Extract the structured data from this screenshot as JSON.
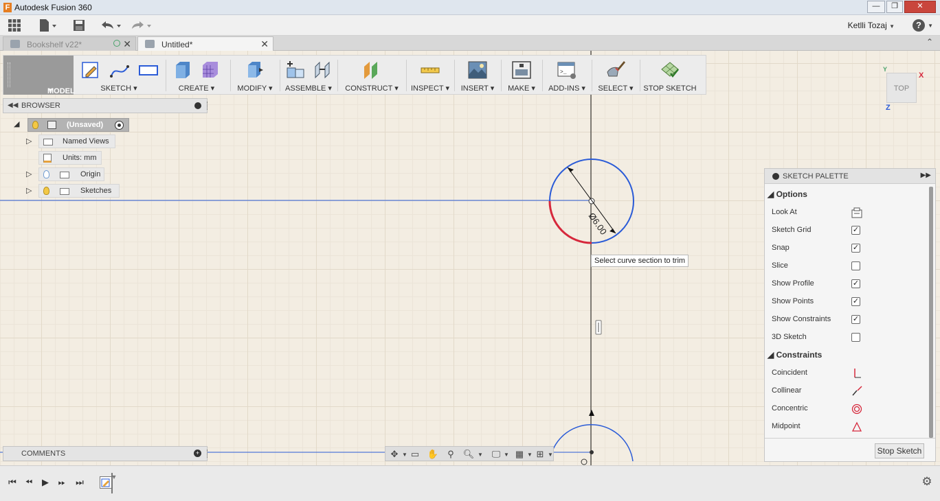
{
  "window": {
    "title": "Autodesk Fusion 360",
    "logo_letter": "F",
    "minimize": "—",
    "maximize": "❐",
    "close": "✕"
  },
  "quick_access": {
    "user_name": "Ketlli Tozaj",
    "help": "?"
  },
  "tabs": [
    {
      "label": "Bookshelf v22*",
      "active": false
    },
    {
      "label": "Untitled*",
      "active": true
    }
  ],
  "ribbon": {
    "workspace": "MODEL",
    "groups": [
      {
        "label": "SKETCH ▾"
      },
      {
        "label": "CREATE ▾"
      },
      {
        "label": "MODIFY ▾"
      },
      {
        "label": "ASSEMBLE ▾"
      },
      {
        "label": "CONSTRUCT ▾"
      },
      {
        "label": "INSPECT ▾"
      },
      {
        "label": "INSERT ▾"
      },
      {
        "label": "MAKE ▾"
      },
      {
        "label": "ADD-INS ▾"
      },
      {
        "label": "SELECT ▾"
      },
      {
        "label": "STOP SKETCH"
      }
    ]
  },
  "browser": {
    "title": "BROWSER",
    "root": "(Unsaved)",
    "items": [
      {
        "label": "Named Views"
      },
      {
        "label": "Units: mm"
      },
      {
        "label": "Origin"
      },
      {
        "label": "Sketches"
      }
    ]
  },
  "comments": {
    "title": "COMMENTS"
  },
  "canvas": {
    "dimension_text": "Ø6.00",
    "tooltip": "Select curve section to trim"
  },
  "viewcube": {
    "face": "TOP",
    "axis_x": "X",
    "axis_y": "Y",
    "axis_z": "Z"
  },
  "palette": {
    "title": "SKETCH PALETTE",
    "options_header": "Options",
    "options": [
      {
        "label": "Look At",
        "type": "icon"
      },
      {
        "label": "Sketch Grid",
        "type": "checkbox",
        "checked": true
      },
      {
        "label": "Snap",
        "type": "checkbox",
        "checked": true
      },
      {
        "label": "Slice",
        "type": "checkbox",
        "checked": false
      },
      {
        "label": "Show Profile",
        "type": "checkbox",
        "checked": true
      },
      {
        "label": "Show Points",
        "type": "checkbox",
        "checked": true
      },
      {
        "label": "Show Constraints",
        "type": "checkbox",
        "checked": true
      },
      {
        "label": "3D Sketch",
        "type": "checkbox",
        "checked": false
      }
    ],
    "constraints_header": "Constraints",
    "constraints": [
      {
        "label": "Coincident"
      },
      {
        "label": "Collinear"
      },
      {
        "label": "Concentric"
      },
      {
        "label": "Midpoint"
      }
    ],
    "stop_button": "Stop Sketch"
  },
  "colors": {
    "sketch_line": "#2a5bd7",
    "trim_highlight": "#d6283c",
    "canvas_bg": "#f3ede2"
  }
}
